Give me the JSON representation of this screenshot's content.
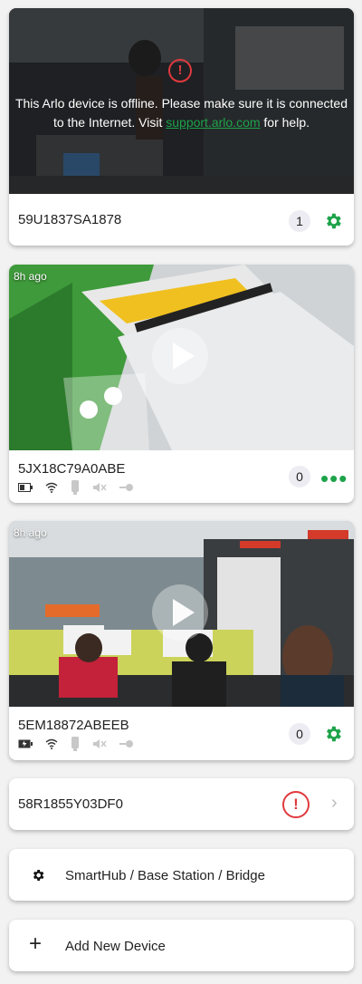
{
  "cards": [
    {
      "name": "59U1837SA1878",
      "offline_message": "This Arlo device is offline. Please make sure it is connected to the Internet. Visit",
      "offline_link": "support.arlo.com",
      "offline_suffix": "for help.",
      "badge": "1",
      "action_icon": "gear-icon"
    },
    {
      "name": "5JX18C79A0ABE",
      "ago": "8h ago",
      "badge": "0",
      "action_icon": "more-dots-icon",
      "status_icons": [
        "battery-icon",
        "wifi-icon",
        "camera-icon",
        "speaker-muted-icon",
        "motion-icon"
      ]
    },
    {
      "name": "5EM18872ABEEB",
      "ago": "8h ago",
      "badge": "0",
      "action_icon": "gear-icon",
      "status_icons": [
        "battery-charging-icon",
        "wifi-icon",
        "camera-icon",
        "speaker-muted-icon",
        "motion-icon"
      ]
    }
  ],
  "offline_row": {
    "name": "58R1855Y03DF0"
  },
  "smarthub": {
    "label": "SmartHub / Base Station / Bridge"
  },
  "add_device": {
    "label": "Add New Device"
  },
  "colors": {
    "accent": "#1da34a",
    "warning": "#e0393e"
  }
}
